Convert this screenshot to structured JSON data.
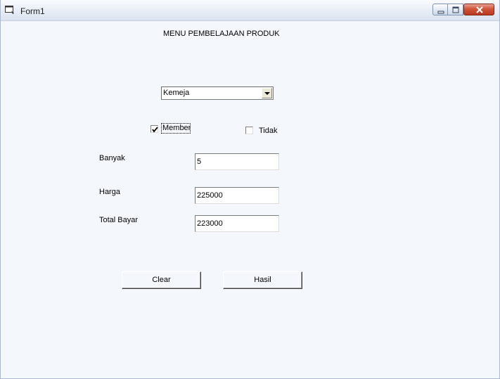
{
  "window": {
    "title": "Form1"
  },
  "form": {
    "heading": "MENU PEMBELAJAAN PRODUK",
    "product_combo": {
      "value": "Kemeja"
    },
    "member_checkbox": {
      "label": "Member",
      "checked": true
    },
    "tidak_checkbox": {
      "label": "Tidak",
      "checked": false
    },
    "fields": {
      "banyak": {
        "label": "Banyak",
        "value": "5"
      },
      "harga": {
        "label": "Harga",
        "value": "225000"
      },
      "total_bayar": {
        "label": "Total Bayar",
        "value": "223000"
      }
    },
    "buttons": {
      "clear": "Clear",
      "hasil": "Hasil"
    }
  },
  "icons": {
    "app": "form-window-icon",
    "minimize": "minimize-icon",
    "maximize": "maximize-icon",
    "close": "close-icon",
    "dropdown": "chevron-down-icon",
    "check": "checkmark-icon"
  },
  "colors": {
    "client_bg": "#f4f7fc",
    "close_button": "#c8452a"
  }
}
